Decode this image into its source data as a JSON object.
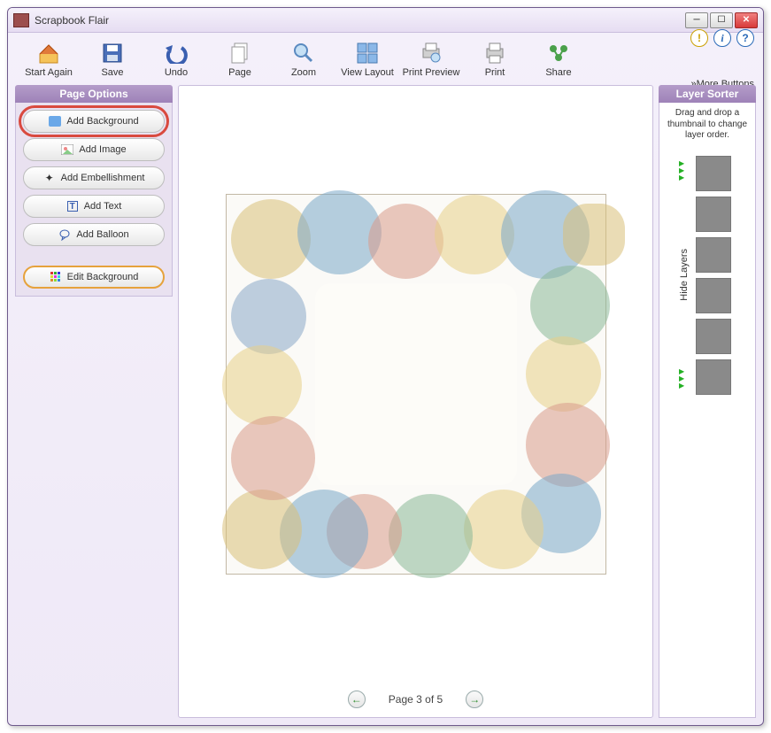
{
  "app": {
    "title": "Scrapbook Flair"
  },
  "toolbar": {
    "start": "Start Again",
    "save": "Save",
    "undo": "Undo",
    "page": "Page",
    "zoom": "Zoom",
    "viewlayout": "View Layout",
    "printpreview": "Print Preview",
    "print": "Print",
    "share": "Share",
    "more": "More Buttons"
  },
  "pageoptions": {
    "header": "Page Options",
    "addbg": "Add Background",
    "addimg": "Add Image",
    "addemb": "Add Embellishment",
    "addtext": "Add Text",
    "addballoon": "Add Balloon",
    "editbg": "Edit Background"
  },
  "layersorter": {
    "header": "Layer Sorter",
    "hint": "Drag and drop a thumbnail to change layer order.",
    "hide": "Hide Layers"
  },
  "pager": {
    "label": "Page 3 of 5"
  }
}
